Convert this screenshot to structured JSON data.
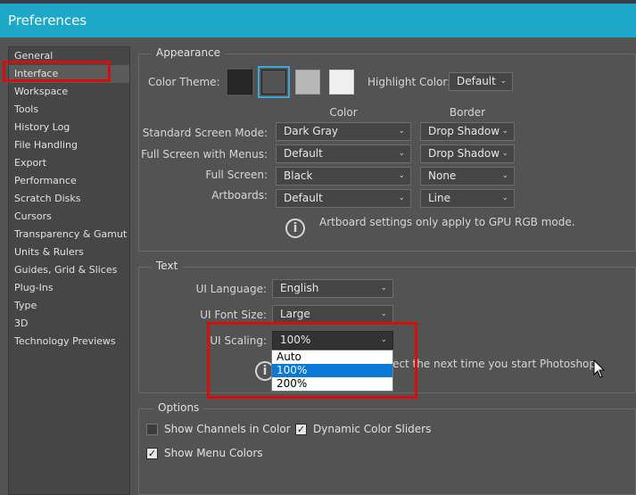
{
  "window": {
    "title": "Preferences"
  },
  "sidebar": {
    "items": [
      {
        "label": "General"
      },
      {
        "label": "Interface",
        "active": true
      },
      {
        "label": "Workspace"
      },
      {
        "label": "Tools"
      },
      {
        "label": "History Log"
      },
      {
        "label": "File Handling"
      },
      {
        "label": "Export"
      },
      {
        "label": "Performance"
      },
      {
        "label": "Scratch Disks"
      },
      {
        "label": "Cursors"
      },
      {
        "label": "Transparency & Gamut"
      },
      {
        "label": "Units & Rulers"
      },
      {
        "label": "Guides, Grid & Slices"
      },
      {
        "label": "Plug-Ins"
      },
      {
        "label": "Type"
      },
      {
        "label": "3D"
      },
      {
        "label": "Technology Previews"
      }
    ]
  },
  "appearance": {
    "title": "Appearance",
    "color_theme_label": "Color Theme:",
    "themes": [
      {
        "name": "Darkest",
        "color": "#262626"
      },
      {
        "name": "Dark",
        "color": "#535353",
        "selected": true
      },
      {
        "name": "Medium Gray",
        "color": "#b8b8b8"
      },
      {
        "name": "Light",
        "color": "#f0f0f0"
      }
    ],
    "highlight_color_label": "Highlight Color:",
    "highlight_color_value": "Default",
    "col_color": "Color",
    "col_border": "Border",
    "rows": [
      {
        "label": "Standard Screen Mode:",
        "color": "Dark Gray",
        "border": "Drop Shadow"
      },
      {
        "label": "Full Screen with Menus:",
        "color": "Default",
        "border": "Drop Shadow"
      },
      {
        "label": "Full Screen:",
        "color": "Black",
        "border": "None"
      },
      {
        "label": "Artboards:",
        "color": "Default",
        "border": "Line"
      }
    ],
    "artboard_note": "Artboard settings only apply to GPU RGB mode."
  },
  "text_section": {
    "title": "Text",
    "ui_language_label": "UI Language:",
    "ui_language_value": "English",
    "ui_font_size_label": "UI Font Size:",
    "ui_font_size_value": "Large",
    "ui_scaling_label": "UI Scaling:",
    "ui_scaling_value": "100%",
    "ui_scaling_options": [
      "Auto",
      "100%",
      "200%"
    ],
    "ui_scaling_highlighted": "100%",
    "note_visible_tail": "ect the next time you start Photoshop."
  },
  "options": {
    "title": "Options",
    "show_channels_in_color": {
      "label": "Show Channels in Color",
      "checked": false
    },
    "dynamic_color_sliders": {
      "label": "Dynamic Color Sliders",
      "checked": true
    },
    "show_menu_colors": {
      "label": "Show Menu Colors",
      "checked": true
    }
  },
  "colors": {
    "titlebar": "#1da7c9",
    "panel_bg": "#535353",
    "sidebar_bg": "#464646",
    "annotation_red": "#d90d0d",
    "dropdown_highlight": "#0a78d7",
    "selected_ring": "#3fa6d8"
  }
}
